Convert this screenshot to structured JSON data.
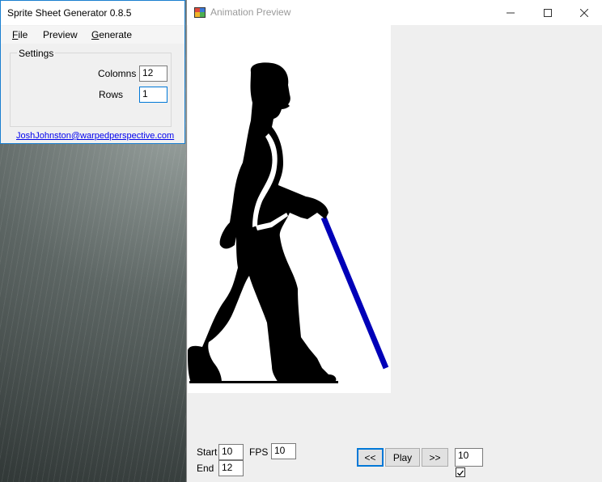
{
  "generator": {
    "title": "Sprite Sheet Generator 0.8.5",
    "menu": [
      {
        "label": "File",
        "mnemonic": "F",
        "rest": "ile"
      },
      {
        "label": "Preview",
        "mnemonic": "",
        "rest": "Preview"
      },
      {
        "label": "Generate",
        "mnemonic": "G",
        "rest": "enerate"
      }
    ],
    "settings": {
      "group_label": "Settings",
      "columns_label": "Colomns",
      "columns_value": "12",
      "rows_label": "Rows",
      "rows_value": "1"
    },
    "email": "JoshJohnston@warpedperspective.com"
  },
  "preview": {
    "title": "Animation Preview",
    "window_buttons": {
      "minimize": "—",
      "maximize": "☐",
      "close": "✕"
    },
    "start_label": "Start",
    "start_value": "10",
    "end_label": "End",
    "end_value": "12",
    "fps_label": "FPS",
    "fps_value": "10",
    "prev_label": "<<",
    "play_label": "Play",
    "next_label": ">>",
    "frame_value": "10",
    "loop_checked": true
  },
  "colors": {
    "cane": "#0000b8",
    "figure": "#000000",
    "accent": "#0078d7"
  }
}
